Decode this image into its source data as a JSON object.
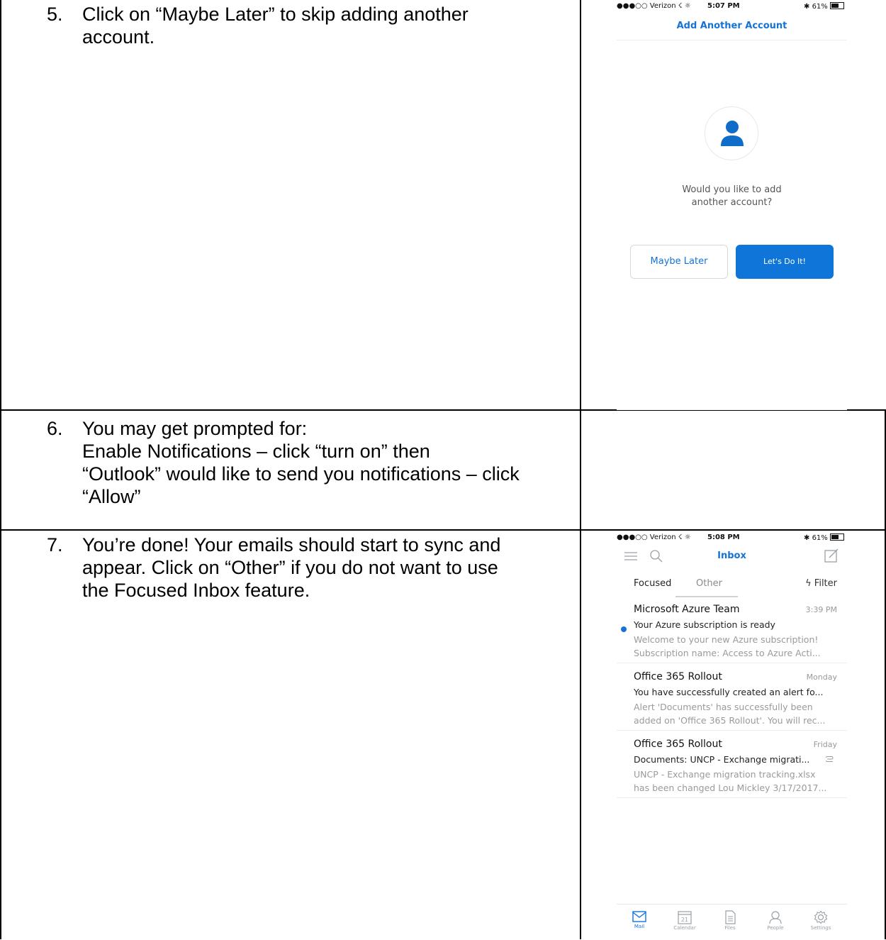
{
  "steps": [
    {
      "number": "5.",
      "lines": [
        "Click on “Maybe Later” to skip adding another",
        "account."
      ]
    },
    {
      "number": "6.",
      "lines": [
        "You may get prompted for:",
        "Enable Notifications – click “turn on” then",
        "“Outlook” would like to send you notifications – click",
        "“Allow”"
      ]
    },
    {
      "number": "7.",
      "lines": [
        "You’re done!  Your emails should start to sync and",
        "appear.  Click on “Other” if you do not want to use",
        "the Focused Inbox feature."
      ]
    }
  ],
  "screen1": {
    "status": {
      "carrier": "●●●○○ Verizon ☇ ☼",
      "time": "5:07 PM",
      "battery": "✱ 61%"
    },
    "title": "Add Another Account",
    "question_lines": [
      "Would you like to add",
      "another account?"
    ],
    "maybe_later": "Maybe Later",
    "lets_do_it": "Let's Do It!",
    "accent": "#1572d6"
  },
  "screen2": {
    "status": {
      "carrier": "●●●○○ Verizon ☇ ☼",
      "time": "5:08 PM",
      "battery": "✱ 61%"
    },
    "title": "Inbox",
    "tabs": {
      "focused": "Focused",
      "other": "Other",
      "filter": "ϟ Filter"
    },
    "emails": [
      {
        "sender": "Microsoft Azure Team",
        "time": "3:39 PM",
        "subject": "Your Azure subscription is ready",
        "preview": [
          "Welcome to your new Azure subscription!",
          "Subscription name: Access to Azure Acti..."
        ],
        "unread": true
      },
      {
        "sender": "Office 365 Rollout",
        "time": "Monday",
        "subject": "You have successfully created an alert fo...",
        "preview": [
          "Alert 'Documents' has successfully been",
          "added on 'Office 365 Rollout'. You will rec..."
        ],
        "unread": false
      },
      {
        "sender": "Office 365 Rollout",
        "time": "Friday",
        "subject": "Documents: UNCP - Exchange migrati...",
        "preview": [
          "UNCP - Exchange migration tracking.xlsx",
          "has been changed Lou Mickley 3/17/2017..."
        ],
        "unread": false,
        "attachment": true
      }
    ],
    "tabbar": [
      {
        "label": "Mail",
        "icon": "mail-icon",
        "active": true
      },
      {
        "label": "Calendar",
        "icon": "calendar-icon",
        "date": "21"
      },
      {
        "label": "Files",
        "icon": "files-icon"
      },
      {
        "label": "People",
        "icon": "people-icon"
      },
      {
        "label": "Settings",
        "icon": "settings-icon"
      }
    ]
  }
}
